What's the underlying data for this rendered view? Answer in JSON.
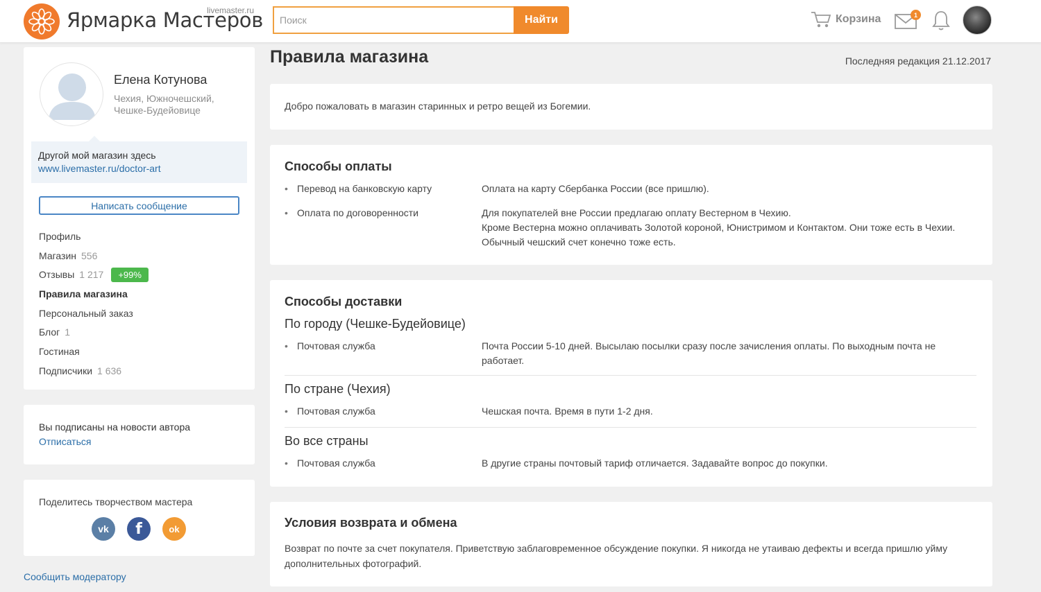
{
  "header": {
    "logo_title": "Ярмарка Мастеров",
    "logo_domain": "livemaster.ru",
    "search_placeholder": "Поиск",
    "search_button": "Найти",
    "cart_label": "Корзина",
    "mail_count": "1"
  },
  "profile": {
    "name": "Елена Котунова",
    "location": "Чехия, Южночешский, Чешке-Будейовице",
    "other_shop_text": "Другой мой магазин здесь",
    "other_shop_link": "www.livemaster.ru/doctor-art",
    "message_button": "Написать сообщение"
  },
  "nav": [
    {
      "label": "Профиль",
      "count": ""
    },
    {
      "label": "Магазин",
      "count": "556"
    },
    {
      "label": "Отзывы",
      "count": "1 217",
      "badge": "+99%"
    },
    {
      "label": "Правила магазина",
      "count": ""
    },
    {
      "label": "Персональный заказ",
      "count": ""
    },
    {
      "label": "Блог",
      "count": "1"
    },
    {
      "label": "Гостиная",
      "count": ""
    },
    {
      "label": "Подписчики",
      "count": "1 636"
    }
  ],
  "subscription": {
    "text": "Вы подписаны на новости автора",
    "link": "Отписаться"
  },
  "share": {
    "title": "Поделитесь творчеством мастера",
    "vk_glyph": "vk",
    "fb_glyph": "f",
    "ok_glyph": "ok"
  },
  "report_link": "Сообщить модератору",
  "main": {
    "title": "Правила магазина",
    "last_edit": "Последняя редакция 21.12.2017",
    "welcome": "Добро пожаловать в магазин старинных и ретро вещей из Богемии.",
    "payment": {
      "title": "Способы оплаты",
      "rows": [
        {
          "method": "Перевод на банковскую карту",
          "desc": "Оплата на карту Сбербанка России (все пришлю)."
        },
        {
          "method": "Оплата по договоренности",
          "desc": "Для покупателей вне России предлагаю оплату Вестерном в Чехию.\nКроме Вестерна можно оплачивать Золотой короной, Юнистримом и Контактом. Они тоже есть в Чехии. Обычный чешский счет конечно тоже есть."
        }
      ]
    },
    "delivery": {
      "title": "Способы доставки",
      "groups": [
        {
          "region": "По городу (Чешке-Будейовице)",
          "method": "Почтовая служба",
          "desc": "Почта России 5-10 дней. Высылаю посылки сразу после зачисления оплаты. По выходным почта не работает."
        },
        {
          "region": "По стране (Чехия)",
          "method": "Почтовая служба",
          "desc": "Чешская почта. Время в пути 1-2 дня."
        },
        {
          "region": "Во все страны",
          "method": "Почтовая служба",
          "desc": "В другие страны почтовый тариф отличается. Задавайте вопрос до покупки."
        }
      ]
    },
    "returns": {
      "title": "Условия возврата и обмена",
      "text": "Возврат по почте за счет покупателя. Приветствую заблаговременное обсуждение покупки. Я никогда не утаиваю дефекты и всегда пришлю уйму дополнительных фотографий."
    }
  },
  "colors": {
    "accent": "#f08a2c",
    "link": "#2b6ea8",
    "badge": "#4cb84c",
    "vk": "#5b7fa6",
    "fb": "#3b5998",
    "ok": "#f29b34"
  }
}
